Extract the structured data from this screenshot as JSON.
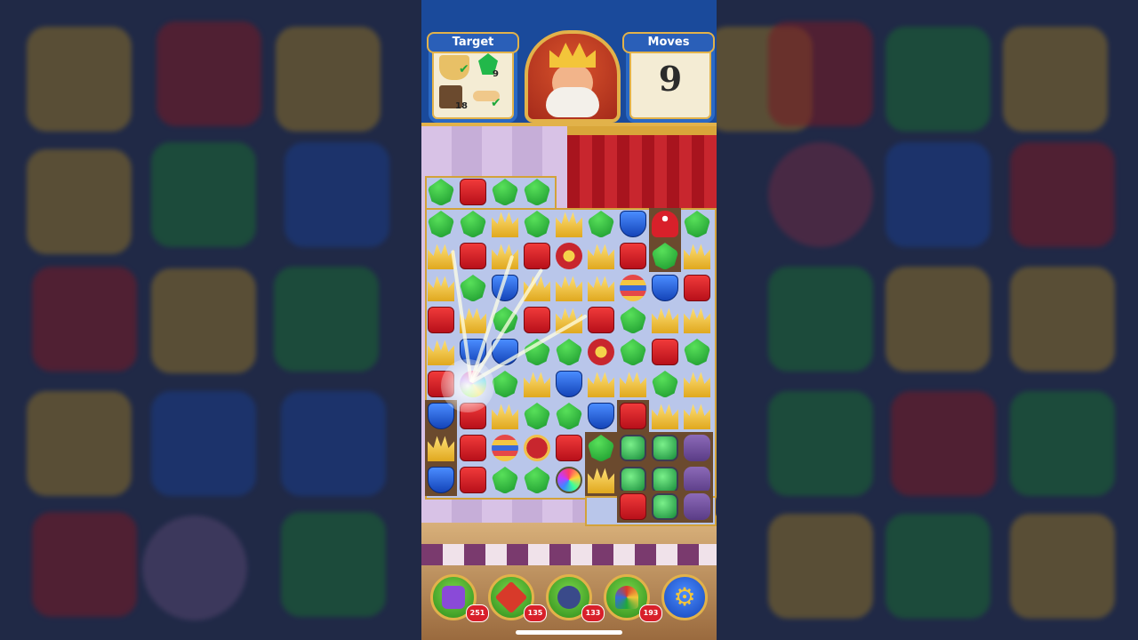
{
  "header": {
    "target_label": "Target",
    "moves_label": "Moves",
    "moves_left": "9",
    "targets": [
      {
        "item": "pot",
        "count": "",
        "done": true
      },
      {
        "item": "emerald",
        "count": "9",
        "done": false
      },
      {
        "item": "dirt",
        "count": "18",
        "done": false
      },
      {
        "item": "bone",
        "count": "",
        "done": true
      }
    ],
    "check_mark": "✔"
  },
  "boosters": [
    {
      "name": "hammer",
      "count": "251"
    },
    {
      "name": "arrow",
      "count": "135"
    },
    {
      "name": "cannon",
      "count": "133"
    },
    {
      "name": "jester-hat",
      "count": "193"
    }
  ],
  "settings_icon": "⚙",
  "board": {
    "rows": [
      "GRGG......",
      "GGCGCGBMG.",
      "CRCRJCRGC.",
      "CGBCCCEBR.",
      "RCGRCRGCC.",
      "CBBGGJGRG.",
      "RDGCBCCGC.",
      "BRCGGBRCC.",
      "CRETRGXXX.",
      "BRGGSCXXX.",
      "......RXXX"
    ],
    "dirt_cells": [
      "1,7",
      "2,7",
      "7,6",
      "8,5",
      "8,6",
      "8,7",
      "8,8",
      "9,5",
      "9,6",
      "9,7",
      "9,8",
      "10,6",
      "10,7",
      "10,8",
      "7,0",
      "8,0",
      "9,0"
    ]
  },
  "colors": {
    "header_blue": "#1a4a9b",
    "gold_trim": "#e2b24a",
    "board_bg": "#b9c6ea"
  }
}
